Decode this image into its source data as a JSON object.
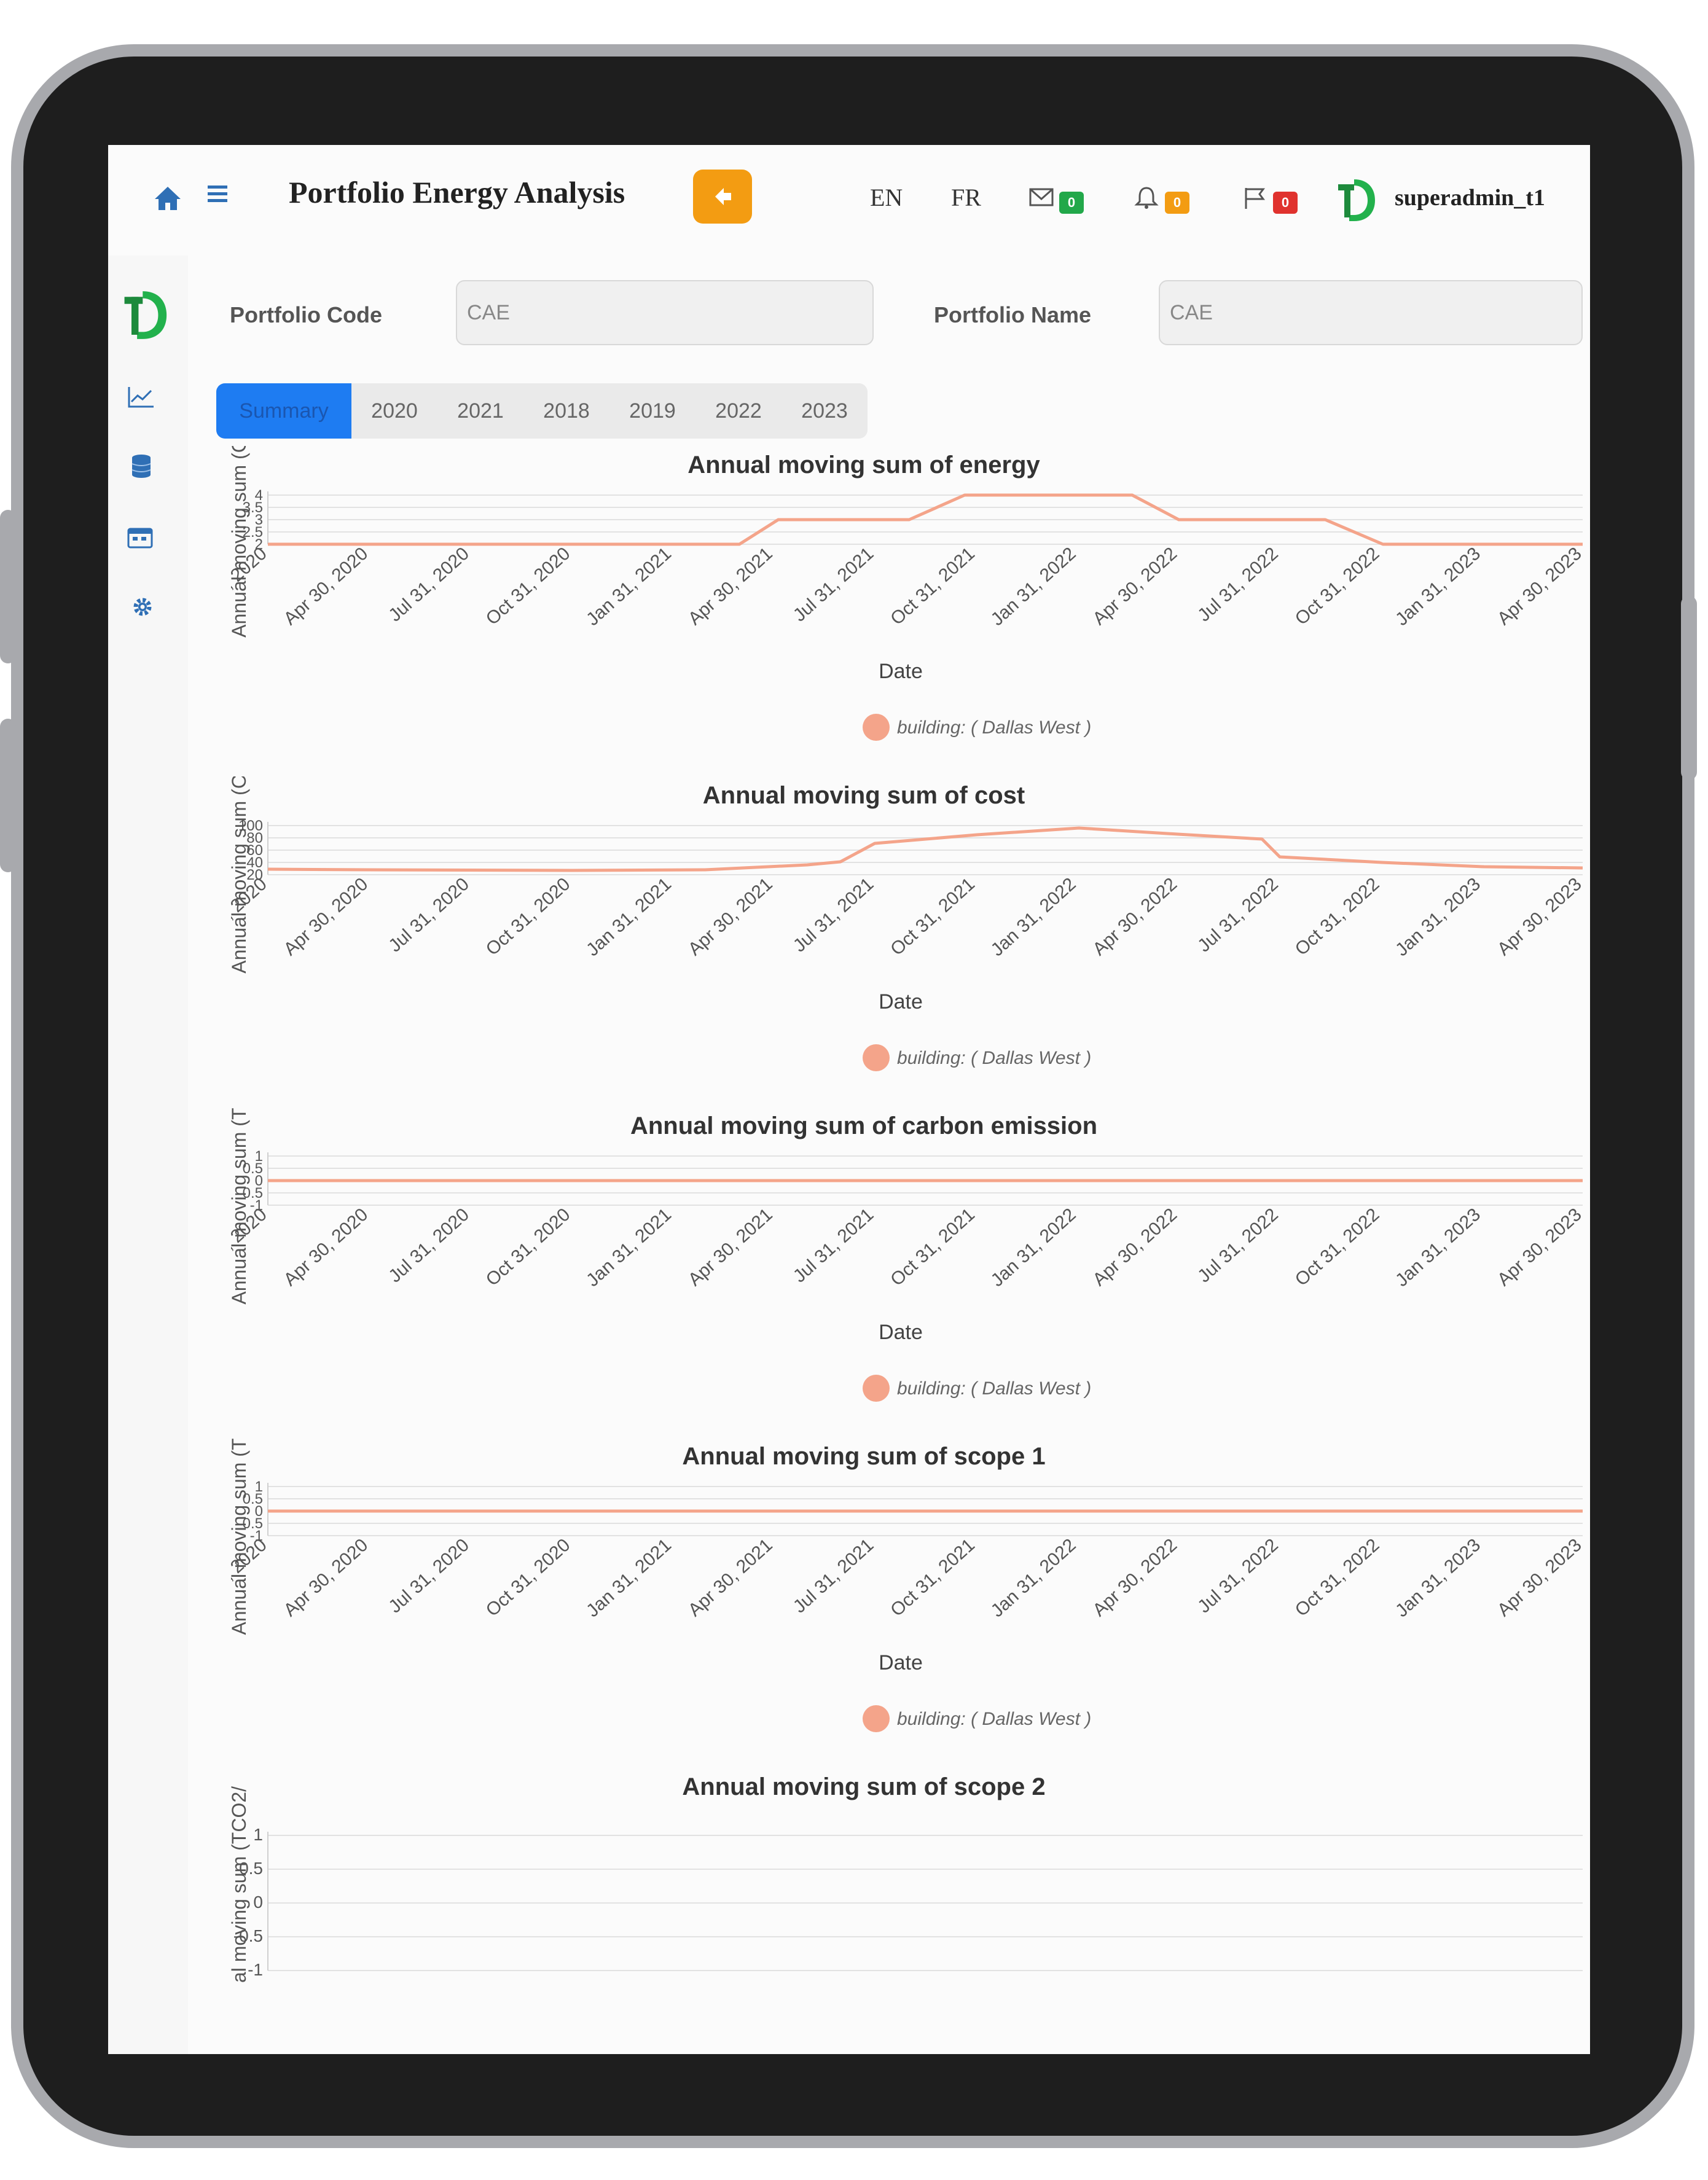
{
  "header": {
    "title": "Portfolio Energy Analysis",
    "languages": [
      "EN",
      "FR"
    ],
    "messages_count": "0",
    "alerts_count": "0",
    "flags_count": "0",
    "username": "superadmin_t1"
  },
  "form": {
    "code_label": "Portfolio Code",
    "code_value": "CAE",
    "name_label": "Portfolio Name",
    "name_value": "CAE"
  },
  "tabs": [
    "Summary",
    "2020",
    "2021",
    "2018",
    "2019",
    "2022",
    "2023"
  ],
  "colors": {
    "accent": "#1e7cf2",
    "back_button": "#f39c12",
    "series": "#f4a48a",
    "brand": "#22b14c"
  },
  "chart_data": [
    {
      "type": "line",
      "title": "Annual moving sum of energy",
      "xlabel": "Date",
      "ylabel": "Annual moving sum (C",
      "x": [
        "Jan 31, 2020",
        "Apr 30, 2020",
        "Jul 31, 2020",
        "Oct 31, 2020",
        "Jan 31, 2021",
        "Apr 30, 2021",
        "Jul 31, 2021",
        "Oct 31, 2021",
        "Jan 31, 2022",
        "Apr 30, 2022",
        "Jul 31, 2022",
        "Oct 31, 2022",
        "Jan 31, 2023",
        "Apr 30, 2023"
      ],
      "yticks": [
        2,
        2.5,
        3,
        3.5,
        4
      ],
      "ytick_labels": [
        "2",
        "2.5",
        "3",
        "3.5",
        "4"
      ],
      "ylim": [
        2,
        4
      ],
      "series": [
        {
          "name": "building: ( Dallas West )",
          "points": [
            [
              "2020-01-31",
              2
            ],
            [
              "2021-03-31",
              2
            ],
            [
              "2021-05-05",
              3
            ],
            [
              "2021-08-31",
              3
            ],
            [
              "2021-10-20",
              4
            ],
            [
              "2022-03-20",
              4
            ],
            [
              "2022-05-01",
              3
            ],
            [
              "2022-09-10",
              3
            ],
            [
              "2022-11-01",
              2
            ],
            [
              "2023-04-30",
              2
            ]
          ]
        }
      ]
    },
    {
      "type": "line",
      "title": "Annual moving sum of cost",
      "xlabel": "Date",
      "ylabel": "Annual moving sum (Co",
      "x": [
        "Jan 31, 2020",
        "Apr 30, 2020",
        "Jul 31, 2020",
        "Oct 31, 2020",
        "Jan 31, 2021",
        "Apr 30, 2021",
        "Jul 31, 2021",
        "Oct 31, 2021",
        "Jan 31, 2022",
        "Apr 30, 2022",
        "Jul 31, 2022",
        "Oct 31, 2022",
        "Jan 31, 2023",
        "Apr 30, 2023"
      ],
      "yticks": [
        20,
        40,
        60,
        80,
        100
      ],
      "ytick_labels": [
        "20",
        "40",
        "60",
        "80",
        "100"
      ],
      "ylim": [
        20,
        100
      ],
      "series": [
        {
          "name": "building: ( Dallas West )",
          "points": [
            [
              "2020-01-31",
              29
            ],
            [
              "2020-05-01",
              28
            ],
            [
              "2020-10-31",
              27
            ],
            [
              "2021-02-28",
              28
            ],
            [
              "2021-05-31",
              36
            ],
            [
              "2021-06-30",
              41
            ],
            [
              "2021-07-31",
              71
            ],
            [
              "2021-10-31",
              85
            ],
            [
              "2022-01-31",
              96
            ],
            [
              "2022-04-30",
              86
            ],
            [
              "2022-07-15",
              78
            ],
            [
              "2022-07-31",
              49
            ],
            [
              "2022-10-31",
              40
            ],
            [
              "2023-01-31",
              33
            ],
            [
              "2023-04-30",
              31
            ]
          ]
        }
      ]
    },
    {
      "type": "line",
      "title": "Annual moving sum of carbon emission",
      "xlabel": "Date",
      "ylabel": "Annual moving sum (TC",
      "x": [
        "Jan 31, 2020",
        "Apr 30, 2020",
        "Jul 31, 2020",
        "Oct 31, 2020",
        "Jan 31, 2021",
        "Apr 30, 2021",
        "Jul 31, 2021",
        "Oct 31, 2021",
        "Jan 31, 2022",
        "Apr 30, 2022",
        "Jul 31, 2022",
        "Oct 31, 2022",
        "Jan 31, 2023",
        "Apr 30, 2023"
      ],
      "yticks": [
        -1,
        -0.5,
        0,
        0.5,
        1
      ],
      "ytick_labels": [
        "-1",
        "-0.5",
        "0",
        "0.5",
        "1"
      ],
      "ylim": [
        -1,
        1
      ],
      "series": [
        {
          "name": "building: ( Dallas West )",
          "points": [
            [
              "2020-01-31",
              0
            ],
            [
              "2023-04-30",
              0
            ]
          ]
        }
      ]
    },
    {
      "type": "line",
      "title": "Annual moving sum of scope 1",
      "xlabel": "Date",
      "ylabel": "Annual moving sum (TC",
      "x": [
        "Jan 31, 2020",
        "Apr 30, 2020",
        "Jul 31, 2020",
        "Oct 31, 2020",
        "Jan 31, 2021",
        "Apr 30, 2021",
        "Jul 31, 2021",
        "Oct 31, 2021",
        "Jan 31, 2022",
        "Apr 30, 2022",
        "Jul 31, 2022",
        "Oct 31, 2022",
        "Jan 31, 2023",
        "Apr 30, 2023"
      ],
      "yticks": [
        -1,
        -0.5,
        0,
        0.5,
        1
      ],
      "ytick_labels": [
        "-1",
        "-0.5",
        "0",
        "0.5",
        "1"
      ],
      "ylim": [
        -1,
        1
      ],
      "series": [
        {
          "name": "building: ( Dallas West )",
          "points": [
            [
              "2020-01-31",
              0
            ],
            [
              "2023-04-30",
              0
            ]
          ]
        }
      ]
    },
    {
      "type": "line",
      "title": "Annual moving sum of scope 2",
      "xlabel": "",
      "ylabel": "al moving sum (TCO2/",
      "x": [],
      "yticks": [
        -1,
        -0.5,
        0,
        0.5,
        1
      ],
      "ytick_labels": [
        "-1",
        "-0.5",
        "0",
        "0.5",
        "1"
      ],
      "ylim": [
        -1,
        1
      ],
      "series": []
    }
  ]
}
